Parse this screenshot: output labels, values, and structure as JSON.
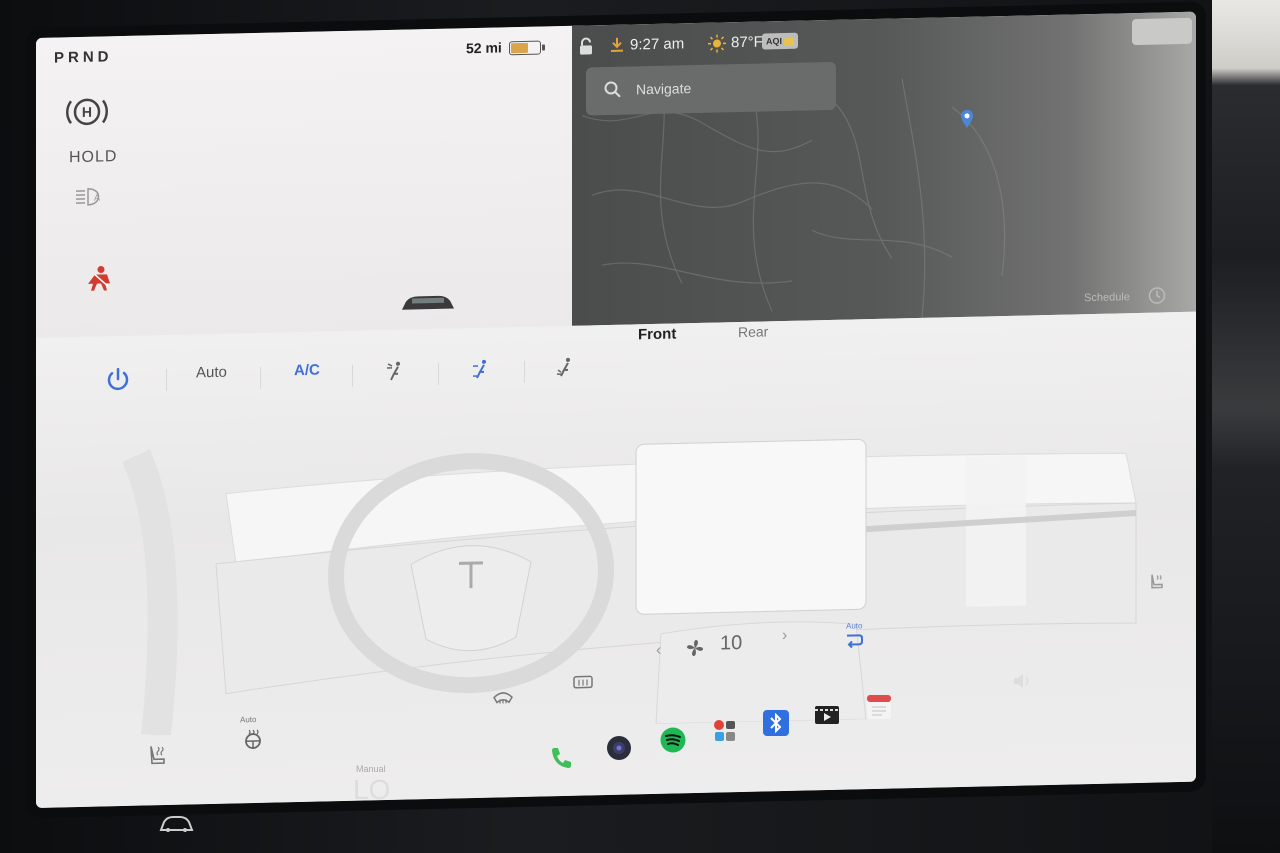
{
  "status": {
    "gears": "PRND",
    "range": "52 mi",
    "battery_level": 0.6,
    "hold_label": "HOLD",
    "time": "9:27 am",
    "temperature": "87°F",
    "aqi_label": "AQI"
  },
  "map": {
    "search_placeholder": "Navigate"
  },
  "climate": {
    "auto_label": "Auto",
    "ac_label": "A/C",
    "front_tab": "Front",
    "rear_tab": "Rear",
    "schedule_label": "Schedule",
    "fan_speed": "10",
    "recirc_auto_label": "Auto",
    "steering_heat_auto_label": "Auto"
  },
  "dock": {
    "temp_mode": "Manual",
    "temp_value": "LO"
  },
  "colors": {
    "accent_blue": "#3f6fd9",
    "battery": "#d9a44a",
    "alert_red": "#d23b2f"
  }
}
